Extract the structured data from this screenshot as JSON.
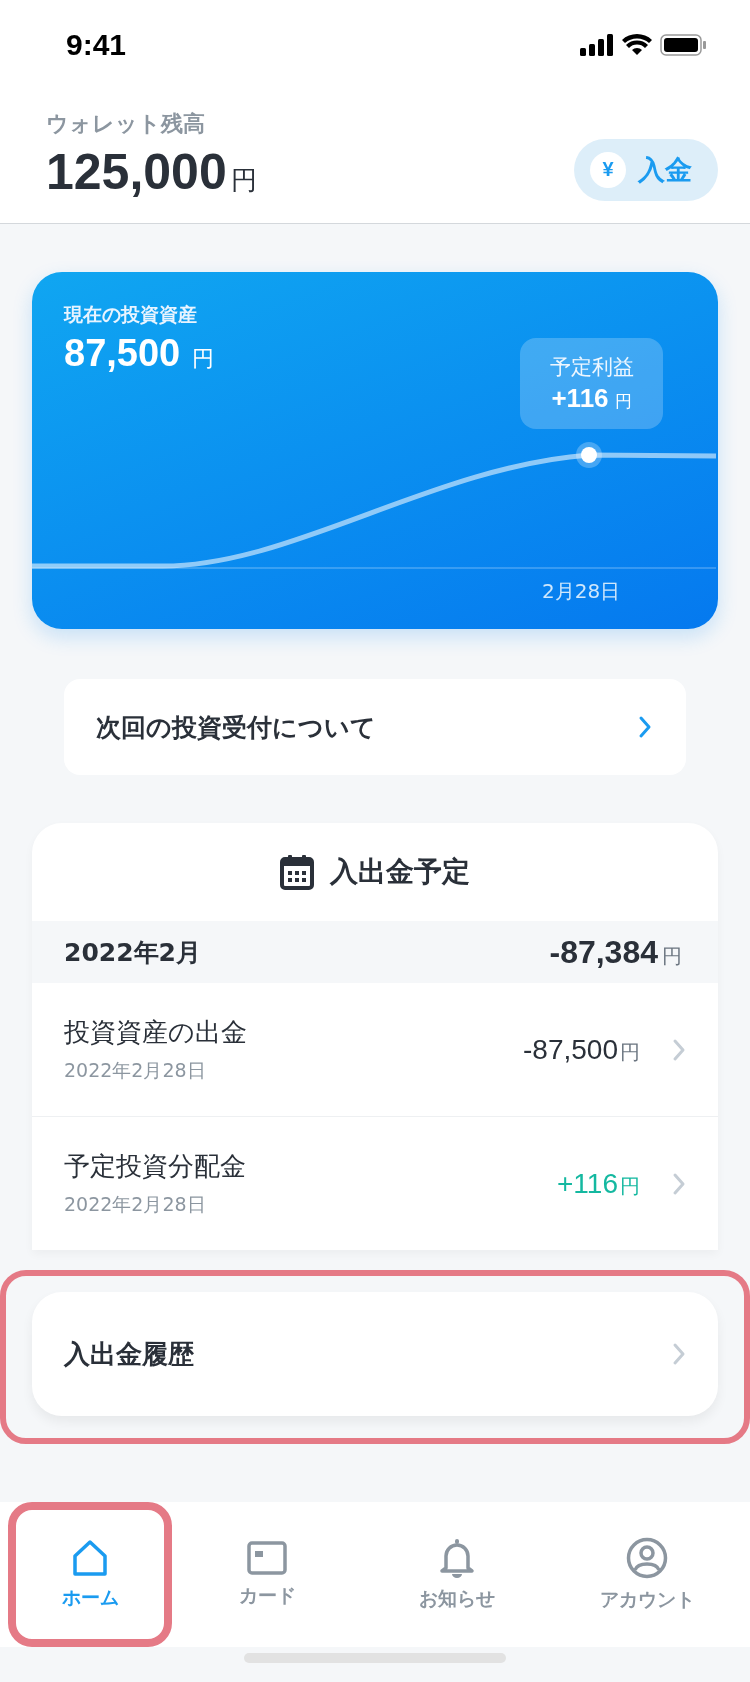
{
  "status_bar": {
    "time": "9:41"
  },
  "wallet": {
    "label": "ウォレット残高",
    "amount": "125,000",
    "unit": "円",
    "deposit_button": {
      "icon": "¥",
      "label": "入金"
    }
  },
  "investment_card": {
    "title": "現在の投資資産",
    "amount": "87,500",
    "unit": "円",
    "tooltip": {
      "label": "予定利益",
      "amount": "+116",
      "unit": "円"
    },
    "date_label": "2月28日"
  },
  "notice_link": {
    "label": "次回の投資受付について"
  },
  "schedule": {
    "title": "入出金予定",
    "month": {
      "label": "2022年2月",
      "total": "-87,384",
      "unit": "円"
    },
    "items": [
      {
        "kind": "withdrawal",
        "title": "投資資産の出金",
        "date": "2022年2月28日",
        "amount": "-87,500",
        "unit": "円"
      },
      {
        "kind": "income",
        "title": "予定投資分配金",
        "date": "2022年2月28日",
        "amount": "+116",
        "unit": "円"
      }
    ]
  },
  "history_link": {
    "label": "入出金履歴",
    "highlighted": true
  },
  "tab_bar": [
    {
      "kind": "home",
      "label": "ホーム",
      "selected": true,
      "highlighted": true
    },
    {
      "kind": "card",
      "label": "カード",
      "selected": false,
      "highlighted": false
    },
    {
      "kind": "bell",
      "label": "お知らせ",
      "selected": false,
      "highlighted": false
    },
    {
      "kind": "account",
      "label": "アカウント",
      "selected": false,
      "highlighted": false
    }
  ]
}
